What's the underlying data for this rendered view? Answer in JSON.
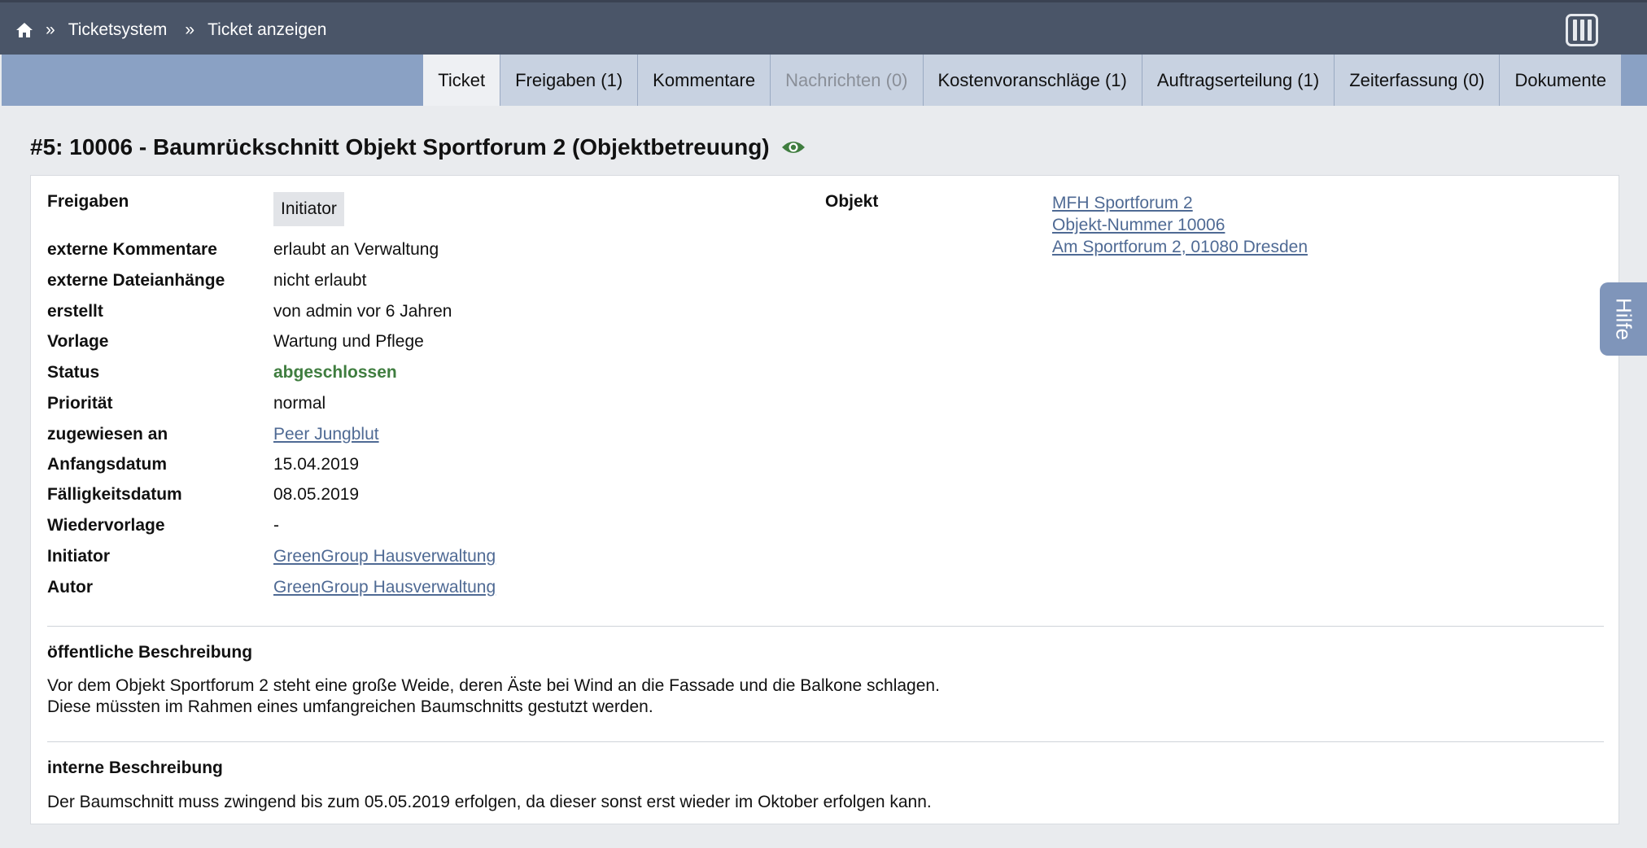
{
  "breadcrumb": {
    "separator": "»",
    "items": [
      "Ticketsystem",
      "Ticket anzeigen"
    ]
  },
  "tabs": [
    {
      "label": "Ticket",
      "state": "active"
    },
    {
      "label": "Freigaben (1)",
      "state": "normal"
    },
    {
      "label": "Kommentare",
      "state": "normal"
    },
    {
      "label": "Nachrichten (0)",
      "state": "disabled"
    },
    {
      "label": "Kostenvoranschläge (1)",
      "state": "normal"
    },
    {
      "label": "Auftragserteilung (1)",
      "state": "normal"
    },
    {
      "label": "Zeiterfassung (0)",
      "state": "normal"
    },
    {
      "label": "Dokumente",
      "state": "normal"
    }
  ],
  "title": "#5: 10006 - Baumrückschnitt Objekt Sportforum 2 (Objektbetreuung)",
  "details": {
    "freigaben_label": "Freigaben",
    "freigaben_value": "Initiator",
    "ext_kommentare_label": "externe Kommentare",
    "ext_kommentare_value": "erlaubt an Verwaltung",
    "ext_anhaenge_label": "externe Dateianhänge",
    "ext_anhaenge_value": "nicht erlaubt",
    "erstellt_label": "erstellt",
    "erstellt_value": "von admin vor 6 Jahren",
    "vorlage_label": "Vorlage",
    "vorlage_value": "Wartung und Pflege",
    "status_label": "Status",
    "status_value": "abgeschlossen",
    "prioritaet_label": "Priorität",
    "prioritaet_value": "normal",
    "zugewiesen_label": "zugewiesen an",
    "zugewiesen_value": "Peer Jungblut",
    "anfang_label": "Anfangsdatum",
    "anfang_value": "15.04.2019",
    "faellig_label": "Fälligkeitsdatum",
    "faellig_value": "08.05.2019",
    "wiedervorlage_label": "Wiedervorlage",
    "wiedervorlage_value": "-",
    "initiator_label": "Initiator",
    "initiator_value": "GreenGroup Hausverwaltung",
    "autor_label": "Autor",
    "autor_value": "GreenGroup Hausverwaltung"
  },
  "objekt": {
    "label": "Objekt",
    "name": "MFH Sportforum 2",
    "nummer": "Objekt-Nummer 10006",
    "adresse": "Am Sportforum 2, 01080 Dresden"
  },
  "public_description": {
    "heading": "öffentliche Beschreibung",
    "line1": "Vor dem Objekt Sportforum 2 steht eine große Weide, deren Äste bei Wind an die Fassade und die Balkone schlagen.",
    "line2": "Diese müssten im Rahmen eines umfangreichen Baumschnitts gestutzt werden."
  },
  "internal_description": {
    "heading": "interne Beschreibung",
    "text": "Der Baumschnitt muss zwingend bis zum 05.05.2019 erfolgen, da dieser sonst erst wieder im Oktober erfolgen kann."
  },
  "help_label": "Hilfe",
  "colors": {
    "topbar": "#4a5568",
    "tabbar": "#8aa1c4",
    "status_green": "#3f7d3f",
    "link": "#4f6a94"
  }
}
